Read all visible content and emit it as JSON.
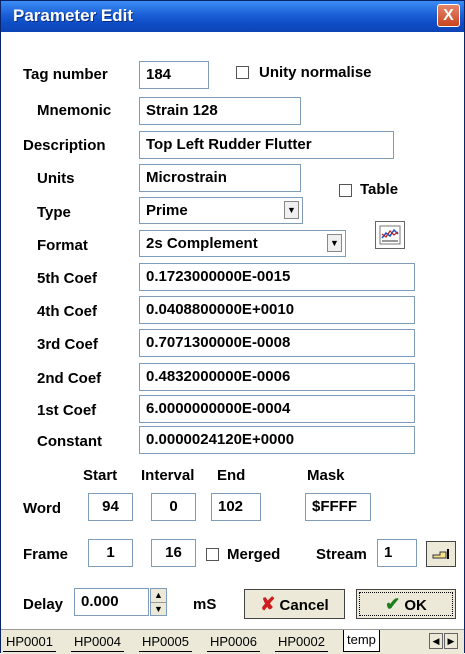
{
  "window": {
    "title": "Parameter Edit",
    "close_glyph": "X"
  },
  "fields": {
    "tag_number": {
      "label": "Tag number",
      "value": "184"
    },
    "unity_normalise": {
      "label": "Unity normalise",
      "checked": false
    },
    "mnemonic": {
      "label": "Mnemonic",
      "value": "Strain 128"
    },
    "description": {
      "label": "Description",
      "value": "Top Left Rudder Flutter"
    },
    "units": {
      "label": "Units",
      "value": "Microstrain"
    },
    "table": {
      "label": "Table",
      "checked": false
    },
    "type": {
      "label": "Type",
      "value": "Prime"
    },
    "format": {
      "label": "Format",
      "value": "2s Complement"
    },
    "coef5": {
      "label": "5th Coef",
      "value": "0.1723000000E-0015"
    },
    "coef4": {
      "label": "4th Coef",
      "value": "0.0408800000E+0010"
    },
    "coef3": {
      "label": "3rd Coef",
      "value": "0.7071300000E-0008"
    },
    "coef2": {
      "label": "2nd Coef",
      "value": "0.4832000000E-0006"
    },
    "coef1": {
      "label": "1st Coef",
      "value": "6.0000000000E-0004"
    },
    "constant": {
      "label": "Constant",
      "value": "0.0000024120E+0000"
    }
  },
  "word": {
    "label": "Word",
    "start_header": "Start",
    "interval_header": "Interval",
    "end_header": "End",
    "mask_header": "Mask",
    "start": "94",
    "interval": "0",
    "end": "102",
    "mask": "$FFFF"
  },
  "frame": {
    "label": "Frame",
    "start": "1",
    "interval": "16",
    "merged_label": "Merged",
    "merged_checked": false,
    "stream_label": "Stream",
    "stream": "1"
  },
  "delay": {
    "label": "Delay",
    "value": "0.000",
    "unit": "mS"
  },
  "buttons": {
    "cancel": "Cancel",
    "ok": "OK",
    "cancel_glyph": "✘",
    "ok_glyph": "✔"
  },
  "tabs": [
    "HP0001",
    "HP0004",
    "HP0005",
    "HP0006",
    "HP0002",
    "temp"
  ],
  "active_tab": "temp",
  "icons": [
    "close-icon",
    "chart-icon",
    "dropdown-arrow-icon",
    "spin-up-icon",
    "spin-down-icon",
    "pointer-icon",
    "cancel-icon",
    "check-icon",
    "scroll-left-icon",
    "scroll-right-icon"
  ],
  "colors": {
    "titlebar": "#0c44b6",
    "close": "#c8441f",
    "cancel_x": "#cc1e1e",
    "ok_check": "#1a7f1a"
  }
}
